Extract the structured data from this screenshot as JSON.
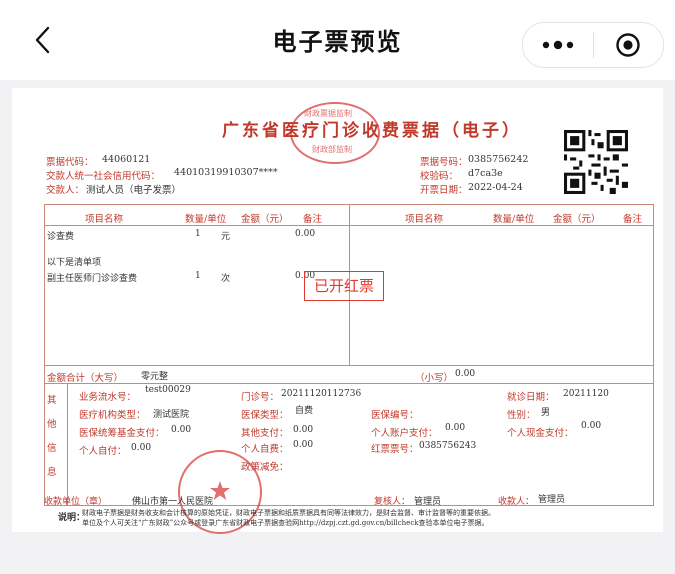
{
  "header": {
    "title": "电子票预览"
  },
  "invoice": {
    "title": "广东省医疗门诊收费票据（电子）",
    "seal_top_text": "财政票据监制",
    "seal_bottom_text": "财政部监制",
    "left_labels": {
      "code": "票据代码：",
      "payer_credit": "交款人统一社会信用代码：",
      "payer": "交款人："
    },
    "code": "44060121",
    "payer_credit": "44010319910307****",
    "payer": "测试人员（电子发票）",
    "right_labels": {
      "number": "票据号码：",
      "check_code": "校验码：",
      "date": "开票日期："
    },
    "number": "0385756242",
    "check_code": "d7ca3e",
    "date": "2022-04-24",
    "columns": [
      "项目名称",
      "数量/单位",
      "金额（元）",
      "备注",
      "项目名称",
      "数量/单位",
      "金额（元）",
      "备注"
    ],
    "rows": [
      {
        "name": "诊查费",
        "qty": "1",
        "unit": "元",
        "amount": "0.00"
      },
      {
        "name": "以下是清单项",
        "qty": "",
        "unit": "",
        "amount": ""
      },
      {
        "name": "副主任医师门诊诊查费",
        "qty": "1",
        "unit": "次",
        "amount": "0.00"
      }
    ],
    "issued_stamp": "已开红票",
    "total_upper_label": "金额合计（大写）",
    "total_upper": "零元整",
    "total_lower_label": "（小写）",
    "total_lower": "0.00",
    "other_info_label": "其他信息",
    "other": {
      "serial_label": "业务流水号：",
      "serial": "test00029",
      "outpatient_label": "门诊号：",
      "outpatient": "20211120112736",
      "visit_date_label": "就诊日期：",
      "visit_date": "20211120",
      "org_type_label": "医疗机构类型：",
      "org_type": "测试医院",
      "insurance_type_label": "医保类型：",
      "insurance_type": "自费",
      "insurance_no_label": "医保编号：",
      "insurance_no": "",
      "gender_label": "性别：",
      "gender": "男",
      "pool_label": "医保统筹基金支付：",
      "pool": "0.00",
      "other_pay_label": "其他支付：",
      "other_pay": "0.00",
      "account_pay_label": "个人账户支付：",
      "account_pay": "0.00",
      "cash_pay_label": "个人现金支付：",
      "cash_pay": "0.00",
      "self_pay_label": "个人自付：",
      "self_pay": "0.00",
      "self_fee_label": "个人自费：",
      "self_fee": "0.00",
      "red_no_label": "红票票号：",
      "red_no": "0385756243",
      "policy_label": "政策减免：",
      "policy": ""
    },
    "unit_label": "收款单位（章）",
    "unit": "佛山市第一人民医院",
    "reviewer_label": "复核人：",
    "reviewer": "管理员",
    "cashier_label": "收款人：",
    "cashier": "管理员",
    "note_label": "说明：",
    "note_line1": "财政电子票据是财务收支和会计核算的原始凭证，财政电子票据和纸质票据具有同等法律效力，是财会监督、审计监督等的重要依据。",
    "note_line2": "单位及个人可关注“广东财政”公众号或登录广东省财政电子票据查验网http://dzpj.czt.gd.gov.cn/billcheck查验本单位电子票据。",
    "hospital_seal": "佛山市第一人民医院"
  },
  "colors": {
    "red": "#c0392b",
    "stamp": "#e03a2f"
  }
}
